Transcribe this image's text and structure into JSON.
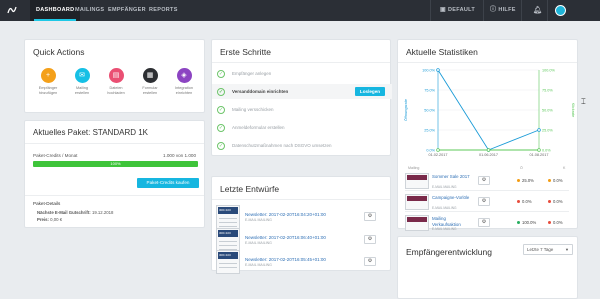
{
  "nav": {
    "items": [
      "DASHBOARD",
      "MAILINGS",
      "EMPFÄNGER",
      "REPORTS"
    ],
    "default_label": "DEFAULT",
    "help_label": "HILFE"
  },
  "quick_actions": {
    "title": "Quick Actions",
    "items": [
      {
        "label1": "Empfänger",
        "label2": "hinzufügen",
        "color": "#f4a01a",
        "icon": "user-plus-icon"
      },
      {
        "label1": "Mailing",
        "label2": "erstellen",
        "color": "#16c0e5",
        "icon": "envelope-icon"
      },
      {
        "label1": "Dateien",
        "label2": "hochladen",
        "color": "#ea4f73",
        "icon": "file-upload-icon"
      },
      {
        "label1": "Formular",
        "label2": "erstellen",
        "color": "#2d2f33",
        "icon": "form-icon"
      },
      {
        "label1": "Integration",
        "label2": "einrichten",
        "color": "#8c44c2",
        "icon": "integration-icon"
      }
    ]
  },
  "package": {
    "title": "Aktuelles Paket: STANDARD 1K",
    "credits_label": "Paket-Credits / Monat",
    "credits_value": "1.000 von 1.000",
    "progress_label": "100%",
    "progress_fraction": 1.0,
    "buy_button": "Paket-Credits kaufen",
    "details_title": "Paket-Details",
    "next_label": "Nächste E-Mail Gutschrift:",
    "next_value": "19.12.2018",
    "price_label": "Preis:",
    "price_value": "0,00 €"
  },
  "steps": {
    "title": "Erste Schritte",
    "items": [
      {
        "label": "Empfänger anlegen",
        "done": true
      },
      {
        "label": "Versanddomain einrichten",
        "done": true,
        "current": true
      },
      {
        "label": "Mailing versschicken",
        "done": true
      },
      {
        "label": "Anmeldeformular erstellen",
        "done": true
      },
      {
        "label": "Datenschutzmaßnahmen nach DSGVO umsetzen",
        "done": true
      }
    ],
    "action_button": "Loslegen"
  },
  "drafts": {
    "title": "Letzte Entwürfe",
    "items": [
      {
        "title": "Newsletter: 2017-02-20T16:04:20+01:00",
        "sub": "E-MAIL MAILING"
      },
      {
        "title": "Newsletter: 2017-02-20T16:06:40+01:00",
        "sub": "E-MAIL MAILING"
      },
      {
        "title": "Newsletter: 2017-02-20T16:05:45+01:00",
        "sub": "E-MAIL MAILING"
      }
    ]
  },
  "stats": {
    "title": "Aktuelle Statistiken",
    "left_axis_label": "Öffnungsrate",
    "right_axis_label": "Klickrate",
    "left_ticks": [
      "100.0%",
      "75.0%",
      "50.0%",
      "25.0%",
      "0.0%"
    ],
    "right_ticks": [
      "100.0%",
      "75.0%",
      "50.0%",
      "25.0%",
      "0.0%"
    ],
    "x_ticks": [
      "01.02.2017",
      "01.06.2017",
      "01.08.2017"
    ],
    "headers": [
      "Mailing",
      "Ö",
      "K"
    ],
    "rows": [
      {
        "name": "Sommer Sale 2017",
        "sub": "E-MAIL MAILING",
        "open": "25.0%",
        "click": "0.0%",
        "open_color": "#f39c12",
        "click_color": "#f39c12"
      },
      {
        "name": "Campaigne-Vorlöle",
        "sub": "E-MAIL MAILING",
        "open": "0.0%",
        "click": "0.0%",
        "open_color": "#e74c3c",
        "click_color": "#e74c3c"
      },
      {
        "name": "Mailing Verkaufsaktion",
        "sub": "E-MAIL MAILING",
        "open": "100.0%",
        "click": "0.0%",
        "open_color": "#27ae60",
        "click_color": "#e74c3c"
      }
    ]
  },
  "growth": {
    "title": "Empfängerentwicklung",
    "range_value": "Letzte 7 Tage"
  },
  "chart_data": {
    "type": "line",
    "title": "",
    "x": [
      "01.02.2017",
      "01.06.2017",
      "01.08.2017"
    ],
    "series": [
      {
        "name": "Öffnungsrate",
        "values": [
          100.0,
          0.0,
          25.0
        ],
        "color": "#1a9bd7"
      },
      {
        "name": "Klickrate",
        "values": [
          0.0,
          0.0,
          0.0
        ],
        "color": "#5cc85a"
      }
    ],
    "ylim": [
      0,
      100
    ],
    "ylabel": "Öffnungsrate",
    "ylabel_right": "Klickrate",
    "grid": true
  }
}
